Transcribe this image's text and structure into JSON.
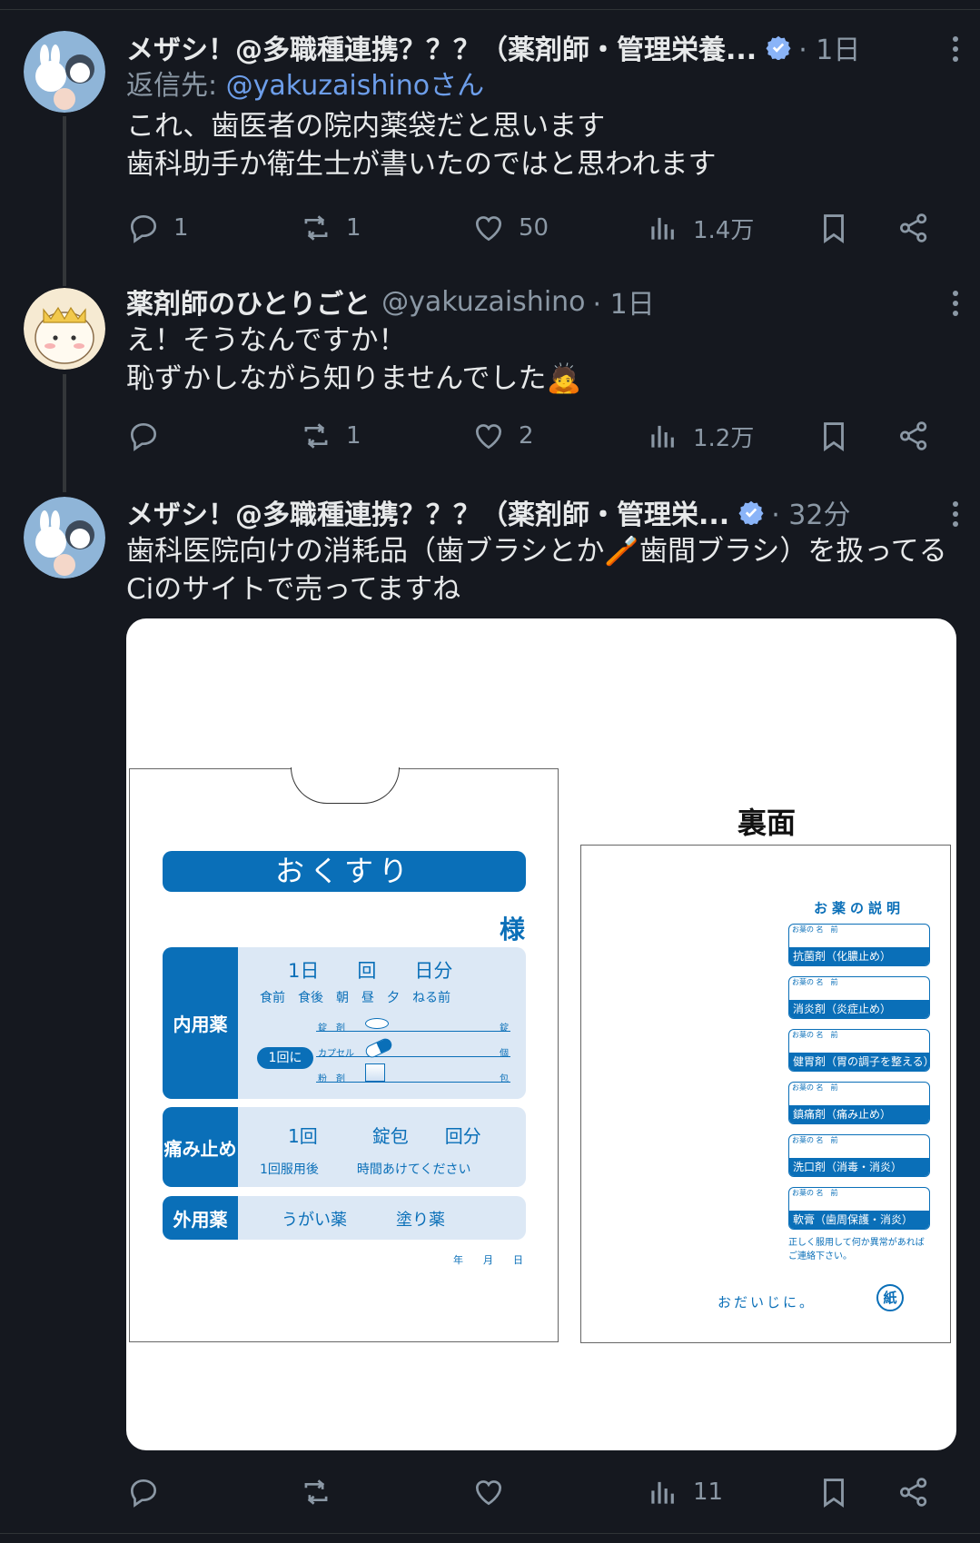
{
  "tweets": [
    {
      "name": "メザシ！@多職種連携？？？（薬剤師・管理栄養...",
      "time": "· 1日",
      "reply_prefix": "返信先: ",
      "reply_handle": "@yakuzaishinoさん",
      "text": "これ、歯医者の院内薬袋だと思います\n歯科助手か衛生士が書いたのではと思われます",
      "replies": "1",
      "retweets": "1",
      "likes": "50",
      "views": "1.4万"
    },
    {
      "name": "薬剤師のひとりごと",
      "handle": "@yakuzaishino",
      "time": "· 1日",
      "text": "え！そうなんですか！\n恥ずかしながら知りませんでした🙇",
      "replies": "",
      "retweets": "1",
      "likes": "2",
      "views": "1.2万"
    },
    {
      "name": "メザシ！@多職種連携？？？（薬剤師・管理栄...",
      "time": "· 32分",
      "text": "歯科医院向けの消耗品（歯ブラシとか🪥歯間ブラシ）を扱ってるCiのサイトで売ってますね",
      "replies": "",
      "retweets": "",
      "likes": "",
      "views": "11"
    }
  ],
  "image": {
    "front": {
      "title": "おくすり",
      "sama": "様",
      "naiyou": "内用薬",
      "dose_line": "1日　　回　　日分",
      "timing": "食前　食後　朝　昼　夕　ねる前",
      "ikkai": "1回に",
      "jozai": "錠　剤",
      "capsule": "カプセル",
      "funzai": "粉　剤",
      "u_jo": "錠",
      "u_ko": "個",
      "u_hou": "包",
      "itamidome": "痛み止め",
      "pain_line": "1回　　　錠包　　回分",
      "pain_note": "1回服用後　　　時間あけてください",
      "gaiyou": "外用薬",
      "ext_items": "うがい薬　　　塗り薬",
      "date": "年　　月　　日"
    },
    "back": {
      "label": "裏面",
      "title": "お薬の説明",
      "small": "お薬の\n名　前",
      "meds": [
        "抗菌剤（化膿止め）",
        "消炎剤（炎症止め）",
        "健胃剤（胃の調子を整える）",
        "鎮痛剤（痛み止め）",
        "洗口剤（消毒・消炎）",
        "軟膏（歯周保護・消炎）"
      ],
      "note": "正しく服用して何か異常があれば\nご連絡下さい。",
      "odaiji": "おだいじに。",
      "logo": "紙"
    }
  },
  "colors": {
    "bg": "#15181f",
    "muted": "#8b98a5",
    "link": "#6d9eea",
    "verified": "#8ab4f8",
    "bag_blue": "#0a6fb8"
  }
}
